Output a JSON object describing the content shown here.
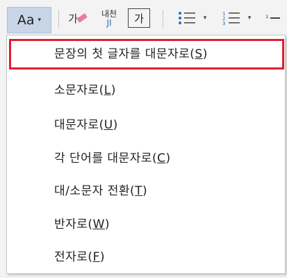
{
  "toolbar": {
    "case_button_label": "Aa",
    "case_button_caret": "▾",
    "phonetic_glyph": "가",
    "enclose_glyph_top": "내천",
    "enclose_glyph_bottom": "JI",
    "boxed_char_glyph": "가",
    "bullets_caret": "▾",
    "numbering_caret": "▾",
    "multilevel_glyph": "¹",
    "icons": [
      "phonetic-guide-icon",
      "eraser-icon",
      "enclose-characters-icon",
      "character-border-icon",
      "bullets-icon",
      "numbering-icon",
      "multilevel-list-icon"
    ]
  },
  "menu": {
    "items": [
      {
        "label": "문장의 첫 글자를 대문자로",
        "key": "S",
        "highlighted": true
      },
      {
        "label": "소문자로",
        "key": "L"
      },
      {
        "label": "대문자로",
        "key": "U"
      },
      {
        "label": "각 단어를 대문자로",
        "key": "C"
      },
      {
        "label": "대/소문자 전환",
        "key": "T"
      },
      {
        "label": "반자로",
        "key": "W"
      },
      {
        "label": "전자로",
        "key": "F"
      }
    ]
  },
  "colors": {
    "highlight_border": "#e0202c",
    "case_button_bg": "#c8d6e8",
    "eraser_pink": "#e97aa6",
    "accent_blue": "#2b6cb5"
  }
}
